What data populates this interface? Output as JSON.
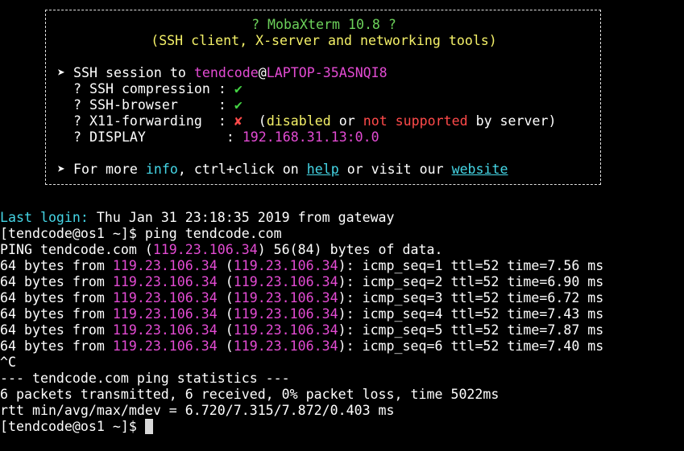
{
  "banner": {
    "title": "? MobaXterm 10.8 ?",
    "subtitle": "(SSH client, X-server and networking tools)",
    "session": {
      "arrow": "➤",
      "prefix": "SSH session to ",
      "user": "tendcode",
      "at": "@",
      "host": "LAPTOP-35ASNQI8"
    },
    "features": [
      {
        "bullet": "?",
        "label": "SSH compression",
        "sep": " : ",
        "status": "✔"
      },
      {
        "bullet": "?",
        "label": "SSH-browser",
        "sep": "     : ",
        "status": "✔"
      },
      {
        "bullet": "?",
        "label": "X11-forwarding",
        "sep": "  : ",
        "status": "✘",
        "note_open": "  (",
        "note_disabled": "disabled",
        "note_or": " or ",
        "note_not_supported": "not supported",
        "note_close": " by server)"
      },
      {
        "bullet": "?",
        "label": "DISPLAY",
        "sep": "          : ",
        "value": "192.168.31.13:0.0"
      }
    ],
    "info": {
      "arrow": "➤",
      "text1": " For more ",
      "info_word": "info",
      "text2": ", ctrl+click on ",
      "help_link": "help",
      "text3": " or visit our ",
      "website_link": "website"
    }
  },
  "terminal": {
    "last_login_label": "Last login:",
    "last_login_value": " Thu Jan 31 23:18:35 2019 from gateway",
    "prompt": "[tendcode@os1 ~]$ ",
    "command": "ping tendcode.com",
    "ping_header": {
      "prefix": "PING tendcode.com (",
      "ip": "119.23.106.34",
      "suffix": ") 56(84) bytes of data."
    },
    "replies": [
      {
        "bytes": "64 bytes from ",
        "ip": "119.23.106.34",
        "ip2": "119.23.106.34",
        "rest": "): icmp_seq=1 ttl=52 time=7.56 ms"
      },
      {
        "bytes": "64 bytes from ",
        "ip": "119.23.106.34",
        "ip2": "119.23.106.34",
        "rest": "): icmp_seq=2 ttl=52 time=6.90 ms"
      },
      {
        "bytes": "64 bytes from ",
        "ip": "119.23.106.34",
        "ip2": "119.23.106.34",
        "rest": "): icmp_seq=3 ttl=52 time=6.72 ms"
      },
      {
        "bytes": "64 bytes from ",
        "ip": "119.23.106.34",
        "ip2": "119.23.106.34",
        "rest": "): icmp_seq=4 ttl=52 time=7.43 ms"
      },
      {
        "bytes": "64 bytes from ",
        "ip": "119.23.106.34",
        "ip2": "119.23.106.34",
        "rest": "): icmp_seq=5 ttl=52 time=7.87 ms"
      },
      {
        "bytes": "64 bytes from ",
        "ip": "119.23.106.34",
        "ip2": "119.23.106.34",
        "rest": "): icmp_seq=6 ttl=52 time=7.40 ms"
      }
    ],
    "interrupt": "^C",
    "stats_header": "--- tendcode.com ping statistics ---",
    "stats_line": "6 packets transmitted, 6 received, 0% packet loss, time 5022ms",
    "rtt_line": "rtt min/avg/max/mdev = 6.720/7.315/7.872/0.403 ms",
    "final_prompt": "[tendcode@os1 ~]$ "
  },
  "colors": {
    "background": "#000000",
    "text": "#ffffff",
    "green": "#6cd15a",
    "yellow": "#f4f068",
    "magenta": "#e34bd3",
    "red": "#ff4a4a",
    "cyan": "#45d6e6"
  }
}
